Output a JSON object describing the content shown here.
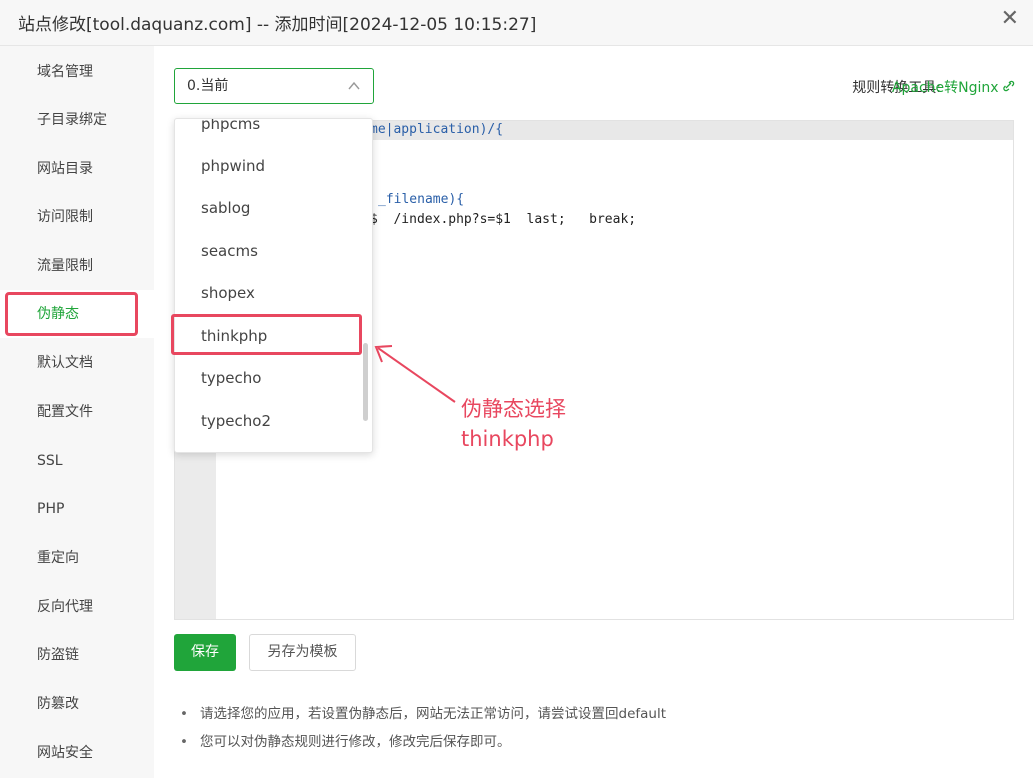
{
  "window": {
    "title": "站点修改[tool.daquanz.com] -- 添加时间[2024-12-05 10:15:27]",
    "close_glyph": "✕"
  },
  "sidebar": {
    "items": [
      {
        "label": "域名管理"
      },
      {
        "label": "子目录绑定"
      },
      {
        "label": "网站目录"
      },
      {
        "label": "访问限制"
      },
      {
        "label": "流量限制"
      },
      {
        "label": "伪静态",
        "active": true
      },
      {
        "label": "默认文档"
      },
      {
        "label": "配置文件"
      },
      {
        "label": "SSL"
      },
      {
        "label": "PHP"
      },
      {
        "label": "重定向"
      },
      {
        "label": "反向代理"
      },
      {
        "label": "防盗链"
      },
      {
        "label": "防篡改"
      },
      {
        "label": "网站安全"
      }
    ]
  },
  "rewrite": {
    "select_value": "0.当前",
    "tool_label": "规则转换工具:",
    "tool_link": "Apache转Nginx",
    "options": [
      "phpcms",
      "phpwind",
      "sablog",
      "seacms",
      "shopex",
      "thinkphp",
      "typecho",
      "typecho2"
    ],
    "selected_option": "thinkphp",
    "code": {
      "line1": "me|application)/{",
      "line2": "_filename){",
      "line3": "$  /index.php?s=$1  last;   break;"
    },
    "save_button": "保存",
    "save_template_button": "另存为模板",
    "notes": [
      "请选择您的应用，若设置伪静态后，网站无法正常访问，请尝试设置回default",
      "您可以对伪静态规则进行修改，修改完后保存即可。"
    ]
  },
  "annotation": {
    "line1": "伪静态选择",
    "line2": "thinkphp"
  },
  "colors": {
    "accent": "#20a53a",
    "highlight": "#e8475f"
  },
  "icons": {
    "close": "close-icon",
    "chevron": "chevron-up-icon",
    "link": "link-icon"
  }
}
